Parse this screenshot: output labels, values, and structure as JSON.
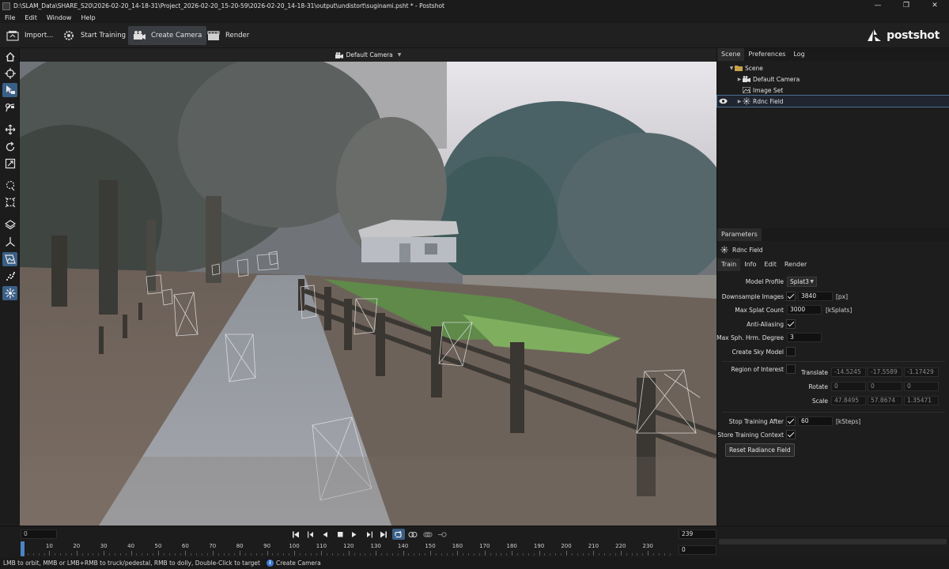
{
  "window": {
    "title": "D:\\SLAM_Data\\SHARE_S20\\2026-02-20_14-18-31\\Project_2026-02-20_15-20-59\\2026-02-20_14-18-31\\output\\undistort\\suginami.psht * - Postshot",
    "controls": [
      "—",
      "❐",
      "✕"
    ]
  },
  "menu": [
    "File",
    "Edit",
    "Window",
    "Help"
  ],
  "toolbar": {
    "import": "Import...",
    "start_training": "Start Training",
    "create_camera": "Create Camera",
    "render": "Render",
    "logo_text": "postshot"
  },
  "viewport": {
    "camera_label": "Default Camera",
    "camera_dropdown_icon": "caret-down"
  },
  "scene_panel": {
    "tabs": [
      "Scene",
      "Preferences",
      "Log"
    ],
    "tree": {
      "root": "Scene",
      "default_camera": "Default Camera",
      "image_set": "Image Set",
      "radiance_field": "Rdnc Field"
    }
  },
  "parameters": {
    "title": "Parameters",
    "object": "Rdnc Field",
    "tabs": [
      "Train",
      "Info",
      "Edit",
      "Render"
    ],
    "model_profile_label": "Model Profile",
    "model_profile_value": "Splat3",
    "downsample_label": "Downsample Images",
    "downsample_checked": true,
    "downsample_value": "3840",
    "downsample_unit": "[px]",
    "max_splat_label": "Max Splat Count",
    "max_splat_value": "3000",
    "max_splat_unit": "[kSplats]",
    "anti_aliasing_label": "Anti-Aliasing",
    "anti_aliasing_checked": true,
    "max_sh_label": "Max Sph. Hrm. Degree",
    "max_sh_value": "3",
    "sky_model_label": "Create Sky Model",
    "sky_model_checked": false,
    "roi_label": "Region of Interest",
    "roi_checked": false,
    "translate_label": "Translate",
    "translate": [
      "-14.5245",
      "-17.5589",
      "-1.17429"
    ],
    "rotate_label": "Rotate",
    "rotate": [
      "0",
      "0",
      "0"
    ],
    "scale_label": "Scale",
    "scale": [
      "47.8495",
      "57.8674",
      "1.35471"
    ],
    "stop_training_label": "Stop Training After",
    "stop_training_checked": true,
    "stop_training_value": "60",
    "stop_training_unit": "[kSteps]",
    "store_context_label": "Store Training Context",
    "store_context_checked": true,
    "reset_button": "Reset Radiance Field"
  },
  "timeline": {
    "start_frame": "0",
    "end_frame": "239",
    "current_frame": "0",
    "ticks": [
      "0",
      "10",
      "20",
      "30",
      "40",
      "50",
      "60",
      "70",
      "80",
      "90",
      "100",
      "110",
      "120",
      "130",
      "140",
      "150",
      "160",
      "170",
      "180",
      "190",
      "200",
      "210",
      "220",
      "230"
    ],
    "playhead_frame": 0
  },
  "status": {
    "hint": "LMB to orbit, MMB or LMB+RMB to truck/pedestal, RMB to dolly, Double-Click to target",
    "info_icon": "i",
    "message": "Create Camera"
  },
  "colors": {
    "accent": "#3a5f86",
    "playhead": "#4a86c5"
  }
}
